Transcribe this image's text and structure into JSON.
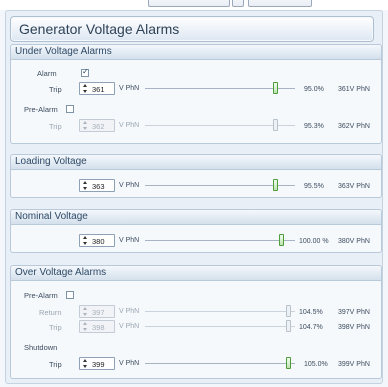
{
  "title": "Generator Voltage Alarms",
  "unit": "V PhN",
  "under_voltage": {
    "header": "Under Voltage Alarms",
    "alarm_label": "Alarm",
    "alarm_checked": true,
    "trip_label": "Trip",
    "trip_value": "361",
    "trip_percent": "95.0%",
    "trip_level_percent": 95.0,
    "trip_readout": "361V PhN",
    "prealarm_label": "Pre-Alarm",
    "prealarm_checked": false,
    "pre_trip_label": "Trip",
    "pre_trip_value": "362",
    "pre_trip_percent": "95.3%",
    "pre_trip_level_percent": 95.3,
    "pre_trip_readout": "362V PhN"
  },
  "loading_voltage": {
    "header": "Loading Voltage",
    "value": "363",
    "percent": "95.5%",
    "level_percent": 95.5,
    "readout": "363V PhN"
  },
  "nominal_voltage": {
    "header": "Nominal Voltage",
    "value": "380",
    "percent": "100.00 %",
    "level_percent": 100.0,
    "readout": "380V PhN"
  },
  "over_voltage": {
    "header": "Over Voltage Alarms",
    "prealarm_label": "Pre-Alarm",
    "prealarm_checked": false,
    "return_label": "Return",
    "return_value": "397",
    "return_percent": "104.5%",
    "return_level_percent": 104.5,
    "return_readout": "397V PhN",
    "pre_trip_label": "Trip",
    "pre_trip_value": "398",
    "pre_trip_percent": "104.7%",
    "pre_trip_level_percent": 104.7,
    "pre_trip_readout": "398V PhN",
    "shutdown_label": "Shutdown",
    "trip_label": "Trip",
    "trip_value": "399",
    "trip_percent": "105.0%",
    "trip_level_percent": 105.0,
    "trip_readout": "399V PhN"
  },
  "colors": {
    "active_thumb": "#4f9c3a",
    "header_text": "#2f4a66"
  }
}
